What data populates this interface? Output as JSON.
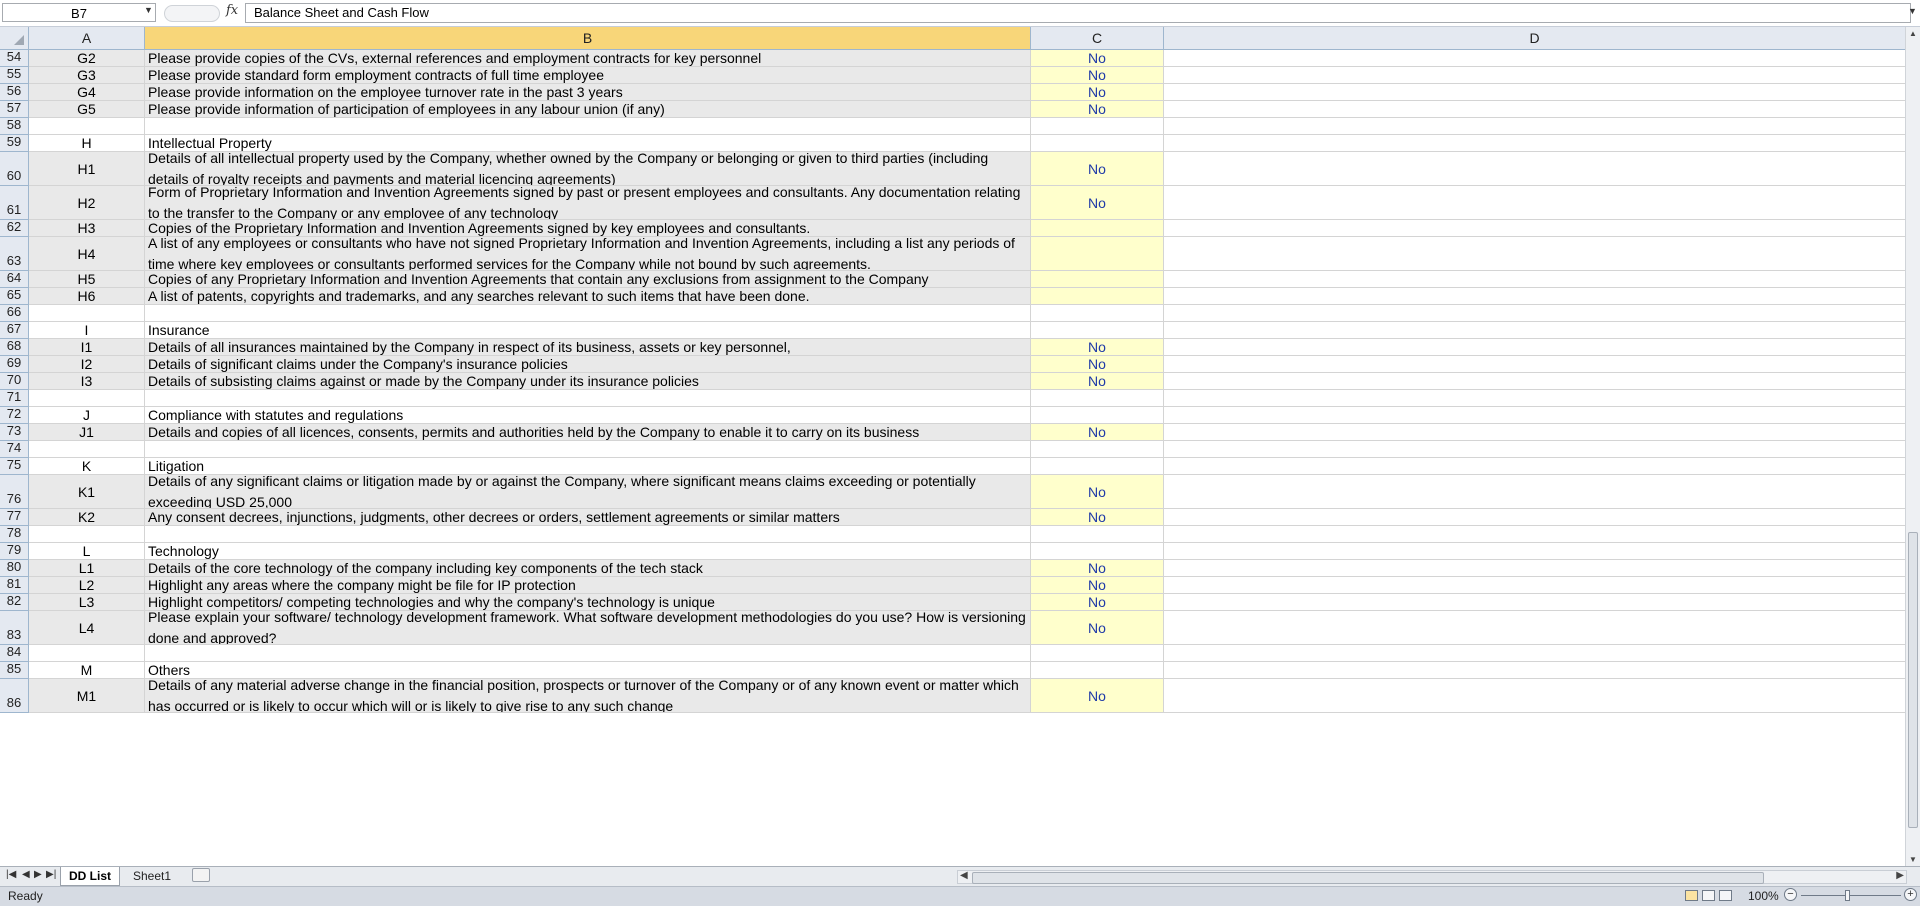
{
  "formula_bar": {
    "name_box": "B7",
    "formula": "Balance Sheet and Cash Flow"
  },
  "columns": [
    "A",
    "B",
    "C",
    "D"
  ],
  "selected_column": "B",
  "rows": [
    {
      "n": "54",
      "type": "item",
      "a": "G2",
      "b": "Please provide copies of the CVs, external references and employment contracts for key personnel",
      "c": "No",
      "lines": 1
    },
    {
      "n": "55",
      "type": "item",
      "a": "G3",
      "b": "Please provide standard form employment contracts of full time employee",
      "c": "No",
      "lines": 1
    },
    {
      "n": "56",
      "type": "item",
      "a": "G4",
      "b": "Please provide information on the employee turnover rate in the past 3 years",
      "c": "No",
      "lines": 1
    },
    {
      "n": "57",
      "type": "item",
      "a": "G5",
      "b": "Please provide information of participation of employees in any labour union (if any)",
      "c": "No",
      "lines": 1
    },
    {
      "n": "58",
      "type": "blank",
      "a": "",
      "b": "",
      "c": "",
      "lines": 1
    },
    {
      "n": "59",
      "type": "section",
      "a": "H",
      "b": "Intellectual Property",
      "c": "",
      "lines": 1
    },
    {
      "n": "60",
      "type": "item",
      "a": "H1",
      "b": "Details of all intellectual property used by the Company, whether owned by the Company or belonging or given to third parties (including details of royalty receipts and payments and material licencing agreements)",
      "c": "No",
      "lines": 2
    },
    {
      "n": "61",
      "type": "item",
      "a": "H2",
      "b": "Form of Proprietary Information and Invention  Agreements signed by past or present employees and consultants. Any documentation relating to the transfer to the Company or any employee of any technology",
      "c": "No",
      "lines": 2
    },
    {
      "n": "62",
      "type": "item",
      "a": "H3",
      "b": "Copies of the Proprietary Information and Invention Agreements signed by key employees and consultants.",
      "c": "",
      "lines": 1
    },
    {
      "n": "63",
      "type": "item",
      "a": "H4",
      "b": "A list of any employees or consultants who have not signed Proprietary Information and Invention Agreements, including a list any periods of time where key employees or consultants performed services for the Company while not bound by such agreements.",
      "c": "",
      "lines": 2
    },
    {
      "n": "64",
      "type": "item",
      "a": "H5",
      "b": "Copies of any Proprietary Information and Invention Agreements that contain any exclusions from assignment to the Company",
      "c": "",
      "lines": 1
    },
    {
      "n": "65",
      "type": "item",
      "a": "H6",
      "b": "A list of patents, copyrights and trademarks, and any searches relevant to such items that have been done.",
      "c": "",
      "lines": 1
    },
    {
      "n": "66",
      "type": "blank",
      "a": "",
      "b": "",
      "c": "",
      "lines": 1
    },
    {
      "n": "67",
      "type": "section",
      "a": "I",
      "b": "Insurance",
      "c": "",
      "lines": 1
    },
    {
      "n": "68",
      "type": "item",
      "a": "I1",
      "b": "Details of all insurances maintained by the Company in respect of its business, assets or key personnel,",
      "c": "No",
      "lines": 1
    },
    {
      "n": "69",
      "type": "item",
      "a": "I2",
      "b": "Details of significant claims under the Company's insurance policies",
      "c": "No",
      "lines": 1
    },
    {
      "n": "70",
      "type": "item",
      "a": "I3",
      "b": "Details of subsisting claims against or made by the Company under its insurance policies",
      "c": "No",
      "lines": 1
    },
    {
      "n": "71",
      "type": "blank",
      "a": "",
      "b": "",
      "c": "",
      "lines": 1
    },
    {
      "n": "72",
      "type": "section",
      "a": "J",
      "b": "Compliance with statutes and regulations",
      "c": "",
      "lines": 1
    },
    {
      "n": "73",
      "type": "item",
      "a": "J1",
      "b": "Details and copies of all licences, consents, permits and authorities held by the Company to enable it to carry on its business",
      "c": "No",
      "lines": 1
    },
    {
      "n": "74",
      "type": "blank",
      "a": "",
      "b": "",
      "c": "",
      "lines": 1
    },
    {
      "n": "75",
      "type": "section",
      "a": "K",
      "b": "Litigation",
      "c": "",
      "lines": 1
    },
    {
      "n": "76",
      "type": "item",
      "a": "K1",
      "b": "Details of any significant claims or litigation made by or against the Company, where significant means claims exceeding or potentially exceeding USD 25,000",
      "c": "No",
      "lines": 2
    },
    {
      "n": "77",
      "type": "item",
      "a": "K2",
      "b": "Any consent decrees, injunctions, judgments, other decrees or orders, settlement agreements or similar matters",
      "c": "No",
      "lines": 1
    },
    {
      "n": "78",
      "type": "blank",
      "a": "",
      "b": "",
      "c": "",
      "lines": 1
    },
    {
      "n": "79",
      "type": "section",
      "a": "L",
      "b": "Technology",
      "c": "",
      "lines": 1
    },
    {
      "n": "80",
      "type": "item",
      "a": "L1",
      "b": "Details of the core technology of the company including key components of the tech stack",
      "c": "No",
      "lines": 1
    },
    {
      "n": "81",
      "type": "item",
      "a": "L2",
      "b": "Highlight any areas where the company might be file for IP protection",
      "c": "No",
      "lines": 1
    },
    {
      "n": "82",
      "type": "item",
      "a": "L3",
      "b": "Highlight competitors/ competing technologies and why the company's technology is unique",
      "c": "No",
      "lines": 1
    },
    {
      "n": "83",
      "type": "item",
      "a": "L4",
      "b": "Please explain your software/ technology development framework. What software development methodologies do you use? How is versioning done and approved?",
      "c": "No",
      "lines": 2
    },
    {
      "n": "84",
      "type": "blank",
      "a": "",
      "b": "",
      "c": "",
      "lines": 1
    },
    {
      "n": "85",
      "type": "section",
      "a": "M",
      "b": "Others",
      "c": "",
      "lines": 1
    },
    {
      "n": "86",
      "type": "item",
      "a": "M1",
      "b": "Details of any material adverse change in the financial position, prospects or turnover of the Company or of any known event or matter which has occurred or is likely to occur which will or is likely to give rise to any such change",
      "c": "No",
      "lines": 2
    }
  ],
  "sheet_tabs": [
    {
      "label": "DD List",
      "active": true
    },
    {
      "label": "Sheet1",
      "active": false
    }
  ],
  "status_bar": {
    "status": "Ready",
    "zoom": "100%",
    "zoom_level": 100
  },
  "icons": {
    "fx": "fx",
    "name_box_dropdown": "chevron-down-icon",
    "new_sheet": "insert-sheet-icon"
  },
  "colors": {
    "section_fill": "#bfbfbf",
    "item_fill": "#e9e9e9",
    "answer_fill": "#ffffcc",
    "answer_text": "#1f3aa8",
    "selected_header": "#f8d679"
  }
}
